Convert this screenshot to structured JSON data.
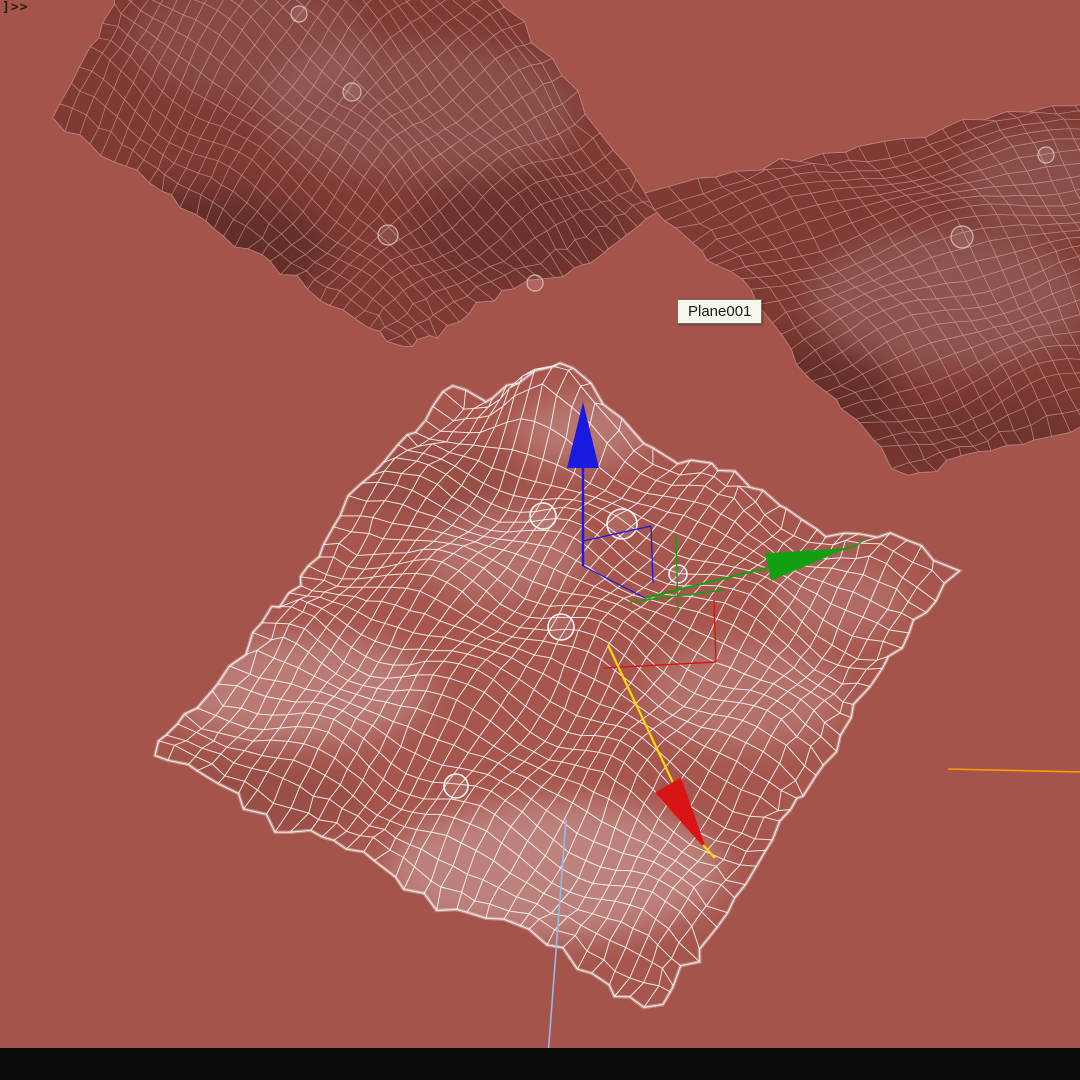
{
  "viewport": {
    "corner_label": "]>>",
    "tooltip_text": "Plane001"
  },
  "selection": {
    "object_name": "Plane001"
  },
  "colors": {
    "background": "#a5544c",
    "status_bar": "#0a0a0a",
    "tooltip_bg": "#f6f6ec",
    "tooltip_border": "#6f6f66",
    "tooltip_fg": "#1a1a1a",
    "corner_label_fg": "#2e1b16",
    "wire_selected": "#ffffff",
    "wire_unselected": "#e6cdc6",
    "cloth_unselected_fill": "#7e3a33",
    "cloth_selected_fill": "#a6564d",
    "axis_x_red": "#d81414",
    "axis_y_green": "#12a012",
    "axis_z_blue": "#1a1ae0",
    "axis_selected_yellow": "#ffd800",
    "line_orange": "#ff9a00",
    "line_blue": "#93bbe8"
  }
}
